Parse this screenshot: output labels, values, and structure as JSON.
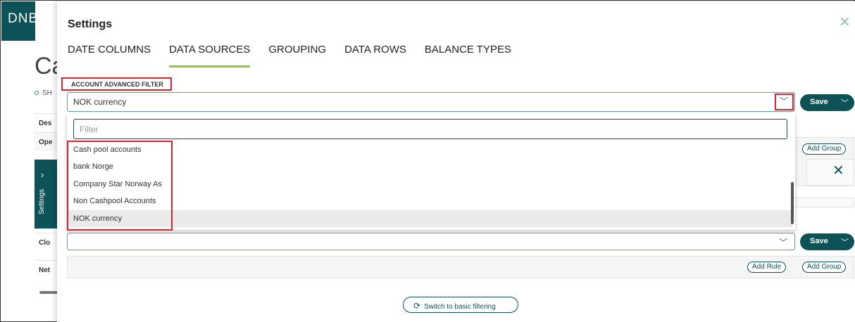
{
  "brand": {
    "logo": "DNB"
  },
  "background": {
    "title": "Ca",
    "subtitle": "SH",
    "rows": [
      "Des",
      "Ope",
      "Clo",
      "Net"
    ],
    "settings_tab_label": "Settings"
  },
  "panel": {
    "title": "Settings",
    "tabs": [
      {
        "label": "DATE COLUMNS"
      },
      {
        "label": "DATA SOURCES"
      },
      {
        "label": "GROUPING"
      },
      {
        "label": "DATA ROWS"
      },
      {
        "label": "BALANCE TYPES"
      }
    ],
    "active_tab": "DATA SOURCES",
    "account_filter": {
      "label": "ACCOUNT ADVANCED FILTER",
      "selected_value": "NOK currency",
      "filter_placeholder": "Filter",
      "options": [
        "Cash pool accounts",
        "bank Norge",
        "Company Star Norway As",
        "Non Cashpool Accounts",
        "NOK currency"
      ]
    },
    "save_label": "Save",
    "add_group_label": "Add Group",
    "add_rule_label": "Add Rule",
    "switch_label": "Switch to basic filtering"
  },
  "colors": {
    "brand": "#0d5257",
    "accent": "#8dc63f",
    "highlight": "#d9232e"
  },
  "icons": [
    "close-icon",
    "chevron-down-icon",
    "chevron-right-icon",
    "refresh-icon"
  ]
}
